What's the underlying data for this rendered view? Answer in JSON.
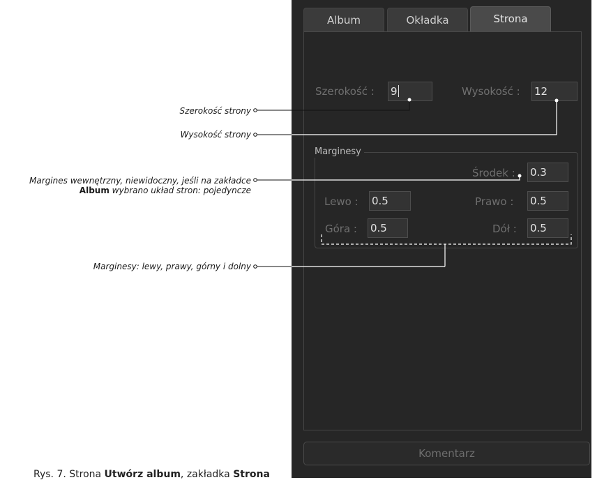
{
  "tabs": [
    {
      "label": "Album",
      "active": false
    },
    {
      "label": "Okładka",
      "active": false
    },
    {
      "label": "Strona",
      "active": true
    }
  ],
  "page_size": {
    "width_label": "Szerokość :",
    "width_value": "9",
    "height_label": "Wysokość :",
    "height_value": "12"
  },
  "margins": {
    "group_title": "Marginesy",
    "center_label": "Środek :",
    "center_value": "0.3",
    "left_label": "Lewo :",
    "left_value": "0.5",
    "right_label": "Prawo :",
    "right_value": "0.5",
    "top_label": "Góra :",
    "top_value": "0.5",
    "bottom_label": "Dół :",
    "bottom_value": "0.5"
  },
  "comment_button": "Komentarz",
  "annotations": {
    "page_width": "Szerokość strony",
    "page_height": "Wysokość strony",
    "inner_margin_line1": "Margines wewnętrzny, niewidoczny, jeśli na zakładce",
    "inner_margin_bold": "Album",
    "inner_margin_line2": " wybrano układ stron: pojedyncze",
    "margins_all": "Marginesy: lewy, prawy, górny i dolny"
  },
  "caption": {
    "prefix": "Rys. 7. Strona ",
    "bold1": "Utwórz album",
    "middle": ", zakładka ",
    "bold2": "Strona"
  },
  "colors": {
    "panel_bg": "#262626",
    "field_bg": "#333333",
    "label_dim": "#6f6f6f"
  }
}
